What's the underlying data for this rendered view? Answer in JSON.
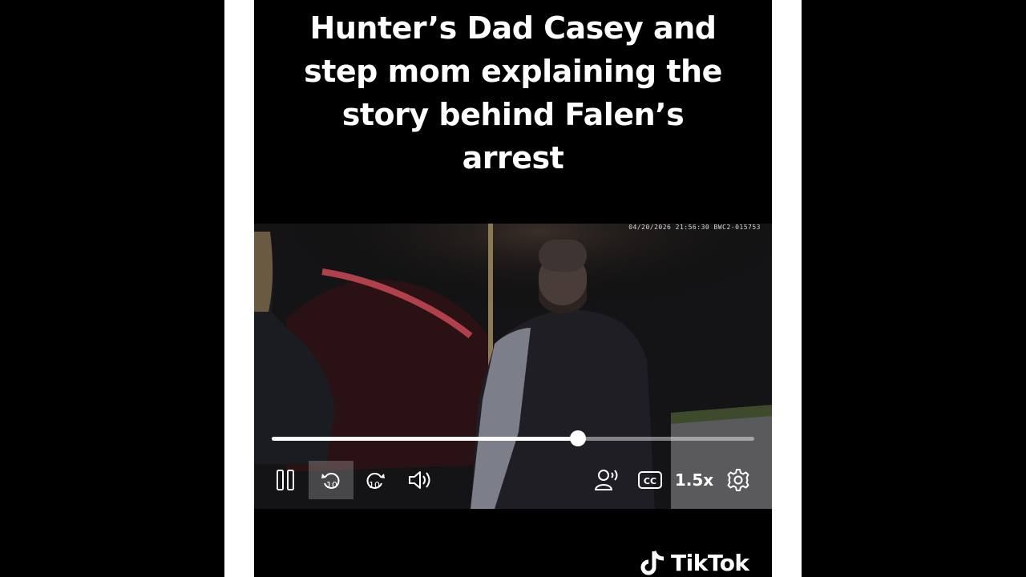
{
  "caption": {
    "lines": [
      "Hunter’s Dad Casey and",
      "step mom explaining the",
      "story behind Falen’s",
      "arrest"
    ]
  },
  "video": {
    "timestamp": "04/20/2026 21:56:30 BWC2-015753",
    "progress_fraction": 0.635,
    "controls": {
      "pause_icon": "pause-icon",
      "rewind_icon": "rewind-10-icon",
      "rewind_label": "10",
      "forward_icon": "forward-10-icon",
      "forward_label": "10",
      "volume_icon": "volume-icon",
      "audio_description_icon": "audio-description-icon",
      "captions_icon": "closed-captions-icon",
      "captions_label": "CC",
      "speed_label": "1.5x",
      "settings_icon": "settings-gear-icon"
    }
  },
  "watermark": {
    "icon": "tiktok-logo-icon",
    "text": "TikTok"
  }
}
